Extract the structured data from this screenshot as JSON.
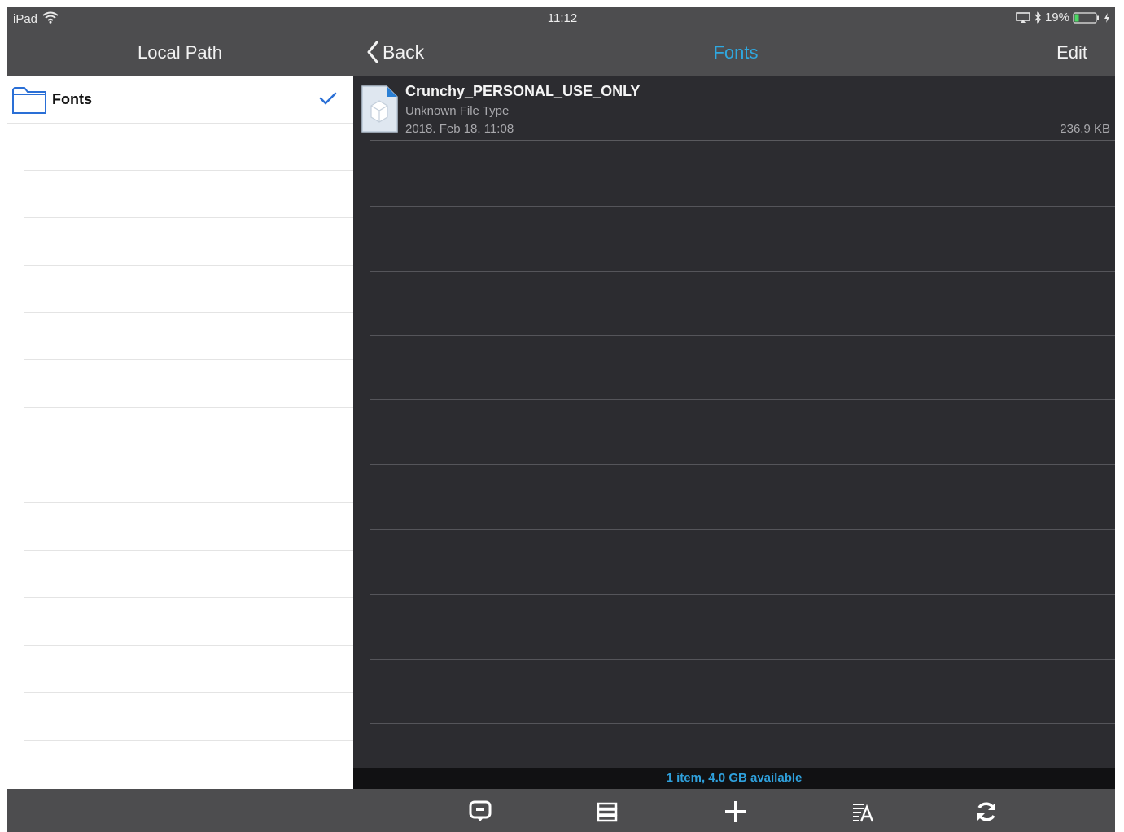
{
  "status_bar": {
    "device": "iPad",
    "time": "11:12",
    "battery": "19%",
    "icons": [
      "wifi-icon",
      "airplay-icon",
      "bluetooth-icon",
      "battery-icon",
      "charging-icon"
    ]
  },
  "left_panel": {
    "title": "Local Path",
    "items": [
      {
        "label": "Fonts",
        "icon": "folder-icon",
        "selected": true
      }
    ]
  },
  "right_panel": {
    "back_label": "Back",
    "title": "Fonts",
    "edit_label": "Edit",
    "files": [
      {
        "name": "Crunchy_PERSONAL_USE_ONLY",
        "type": "Unknown File Type",
        "date": "2018. Feb 18. 11:08",
        "size": "236.9 KB",
        "icon": "unknown-file-icon"
      }
    ],
    "info": "1 item, 4.0 GB available"
  },
  "toolbar": {
    "buttons": [
      "comment-icon",
      "list-view-icon",
      "add-icon",
      "sort-icon",
      "refresh-icon"
    ]
  },
  "colors": {
    "accent": "#2fa8e0",
    "header_bg": "#4d4d4f",
    "content_bg": "#2c2c30",
    "check": "#2a6fd6"
  }
}
